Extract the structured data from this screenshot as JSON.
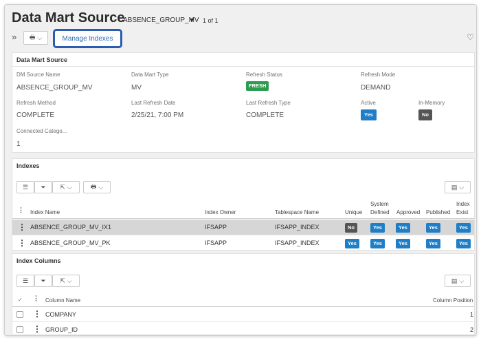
{
  "header": {
    "title": "Data Mart Source",
    "record": "ABSENCE_GROUP_MV",
    "record_caret": "▼",
    "count": "1 of 1",
    "expand_icon": "»",
    "manage_indexes": "Manage Indexes",
    "favorite_icon": "♡"
  },
  "detail": {
    "heading": "Data Mart Source",
    "fields": [
      {
        "label": "DM Source Name",
        "value": "ABSENCE_GROUP_MV"
      },
      {
        "label": "Data Mart Type",
        "value": "MV"
      },
      {
        "label": "Refresh Status",
        "value": "FRESH"
      },
      {
        "label": "Refresh Mode",
        "value": "DEMAND"
      },
      {
        "label": "Refresh Method",
        "value": "COMPLETE"
      },
      {
        "label": "Last Refresh Date",
        "value": "2/25/21, 7:00 PM"
      },
      {
        "label": "Last Refresh Type",
        "value": "COMPLETE"
      },
      {
        "label": "Active",
        "value": "Yes"
      },
      {
        "label": "In-Memory",
        "value": "No"
      },
      {
        "label": "Connected Catego...",
        "value": "1"
      }
    ]
  },
  "indexes": {
    "heading": "Indexes",
    "columns": {
      "name": "Index Name",
      "owner": "Index Owner",
      "tablespace": "Tablespace Name",
      "unique": "Unique",
      "system_defined_1": "System",
      "system_defined_2": "Defined",
      "approved": "Approved",
      "published": "Published",
      "exist_1": "Index",
      "exist_2": "Exist"
    },
    "rows": [
      {
        "name": "ABSENCE_GROUP_MV_IX1",
        "owner": "IFSAPP",
        "tablespace": "IFSAPP_INDEX",
        "unique": "No",
        "system_defined": "Yes",
        "approved": "Yes",
        "published": "Yes",
        "exist": "Yes"
      },
      {
        "name": "ABSENCE_GROUP_MV_PK",
        "owner": "IFSAPP",
        "tablespace": "IFSAPP_INDEX",
        "unique": "Yes",
        "system_defined": "Yes",
        "approved": "Yes",
        "published": "Yes",
        "exist": "Yes"
      }
    ]
  },
  "index_columns": {
    "heading": "Index Columns",
    "columns": {
      "name": "Column Name",
      "position": "Column Position"
    },
    "rows": [
      {
        "name": "COMPANY",
        "position": "1"
      },
      {
        "name": "GROUP_ID",
        "position": "2"
      }
    ]
  },
  "toolbar": {
    "list_icon": "☰",
    "filter_icon": "⏷",
    "export_icon": "⇱",
    "report_icon": "🖶",
    "chevron": "⌵",
    "columns_icon": "▤"
  },
  "colors": {
    "accent": "#2a6fb8",
    "yes": "#1f7ec5",
    "no": "#555555",
    "fresh": "#2e9c4f",
    "outline": "#2a5db0"
  }
}
